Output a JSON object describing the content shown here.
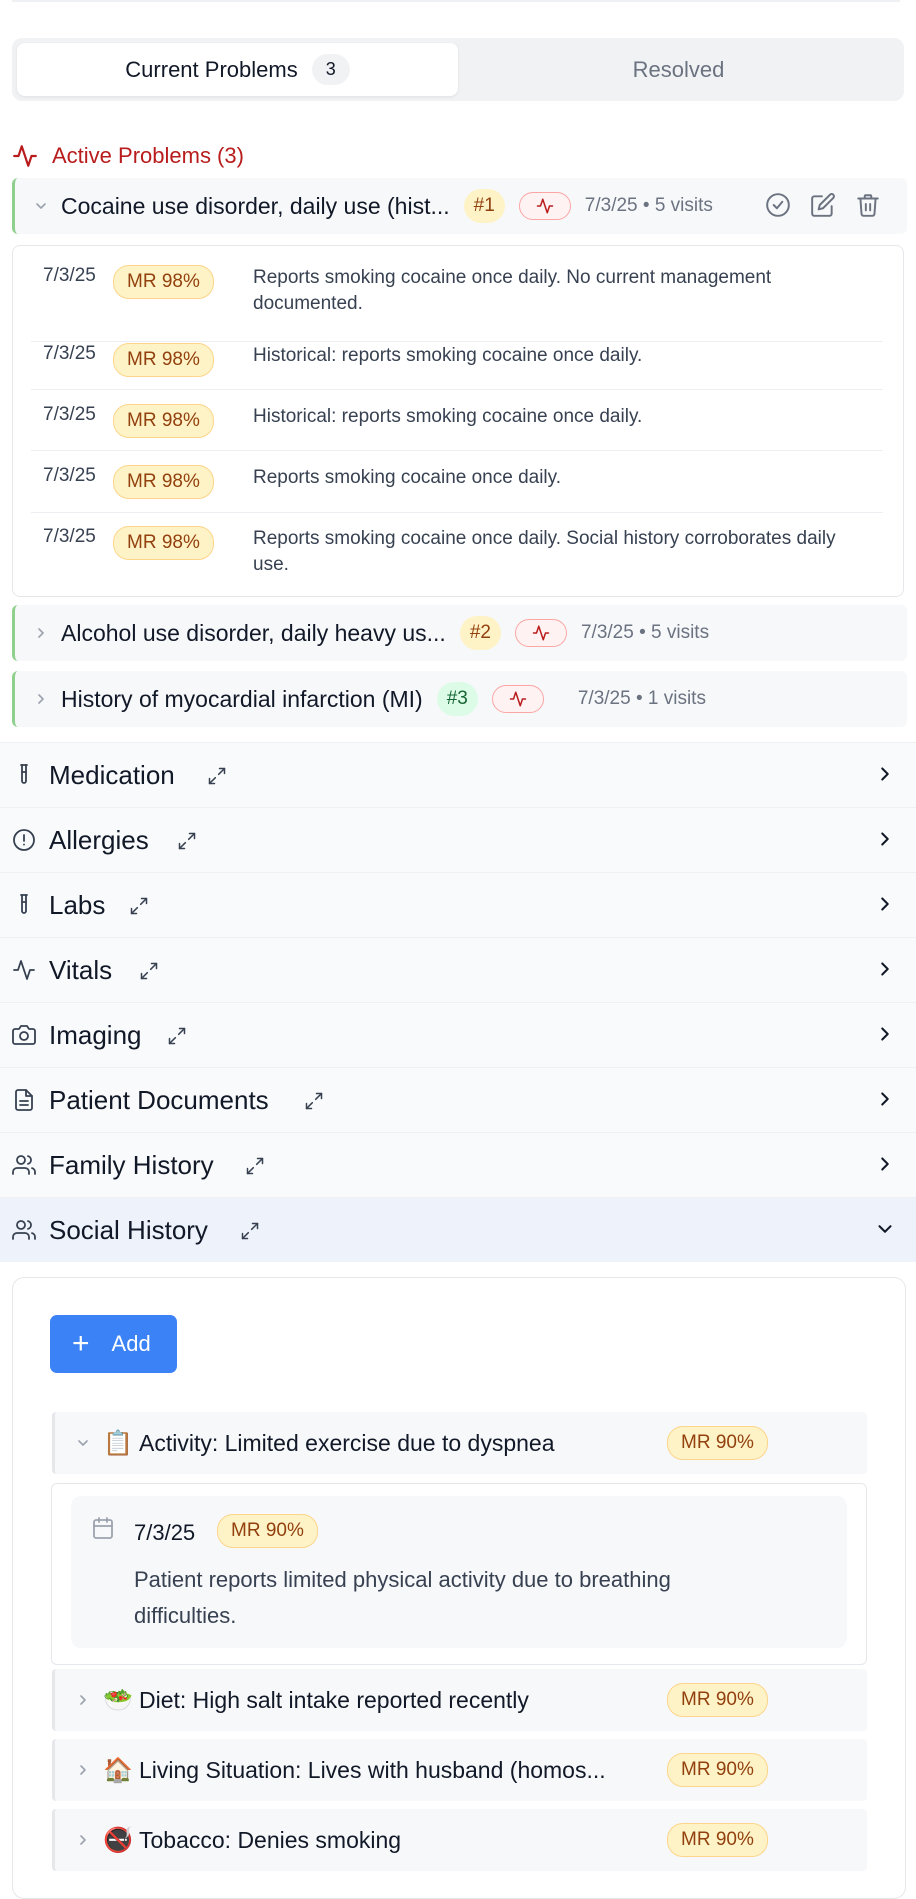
{
  "tabs": {
    "current_label": "Current Problems",
    "current_count": "3",
    "resolved_label": "Resolved"
  },
  "active_problems": {
    "heading": "Active Problems (3)",
    "problems": [
      {
        "title": "Cocaine use disorder, daily use (hist...",
        "number": "#1",
        "meta": "7/3/25 • 5 visits",
        "expanded": true,
        "entries": [
          {
            "date": "7/3/25",
            "badge": "MR 98%",
            "text": "Reports smoking cocaine once daily. No current management documented."
          },
          {
            "date": "7/3/25",
            "badge": "MR 98%",
            "text": "Historical: reports smoking cocaine once daily."
          },
          {
            "date": "7/3/25",
            "badge": "MR 98%",
            "text": "Historical: reports smoking cocaine once daily."
          },
          {
            "date": "7/3/25",
            "badge": "MR 98%",
            "text": "Reports smoking cocaine once daily."
          },
          {
            "date": "7/3/25",
            "badge": "MR 98%",
            "text": "Reports smoking cocaine once daily. Social history corroborates daily use."
          }
        ]
      },
      {
        "title": "Alcohol use disorder, daily heavy us...",
        "number": "#2",
        "meta": "7/3/25 • 5 visits",
        "expanded": false
      },
      {
        "title": "History of myocardial infarction (MI)",
        "number": "#3",
        "meta": "7/3/25 • 1 visits",
        "expanded": false
      }
    ]
  },
  "sections": [
    {
      "label": "Medication",
      "icon": "test-tube-icon"
    },
    {
      "label": "Allergies",
      "icon": "alert-circle-icon"
    },
    {
      "label": "Labs",
      "icon": "test-tube-icon"
    },
    {
      "label": "Vitals",
      "icon": "activity-icon"
    },
    {
      "label": "Imaging",
      "icon": "camera-icon"
    },
    {
      "label": "Patient Documents",
      "icon": "document-icon"
    },
    {
      "label": "Family History",
      "icon": "users-icon"
    },
    {
      "label": "Social History",
      "icon": "users-icon"
    }
  ],
  "social_history": {
    "add_label": "Add",
    "items": [
      {
        "emoji": "📋",
        "label": "Activity: Limited exercise due to dyspnea",
        "badge": "MR 90%",
        "expanded": true,
        "detail": {
          "date": "7/3/25",
          "badge": "MR 90%",
          "text": "Patient reports limited physical activity due to breathing difficulties."
        }
      },
      {
        "emoji": "🥗",
        "label": "Diet: High salt intake reported recently",
        "badge": "MR 90%",
        "expanded": false
      },
      {
        "emoji": "🏠",
        "label": "Living Situation: Lives with husband (homos...",
        "badge": "MR 90%",
        "expanded": false
      },
      {
        "emoji": "🚭",
        "label": "Tobacco: Denies smoking",
        "badge": "MR 90%",
        "expanded": false
      }
    ]
  },
  "colors": {
    "accent_red": "#b91c1c",
    "primary_blue": "#3b82f6",
    "badge_yellow": "#fef3c7",
    "problem_border_green": "#8fd08f"
  }
}
